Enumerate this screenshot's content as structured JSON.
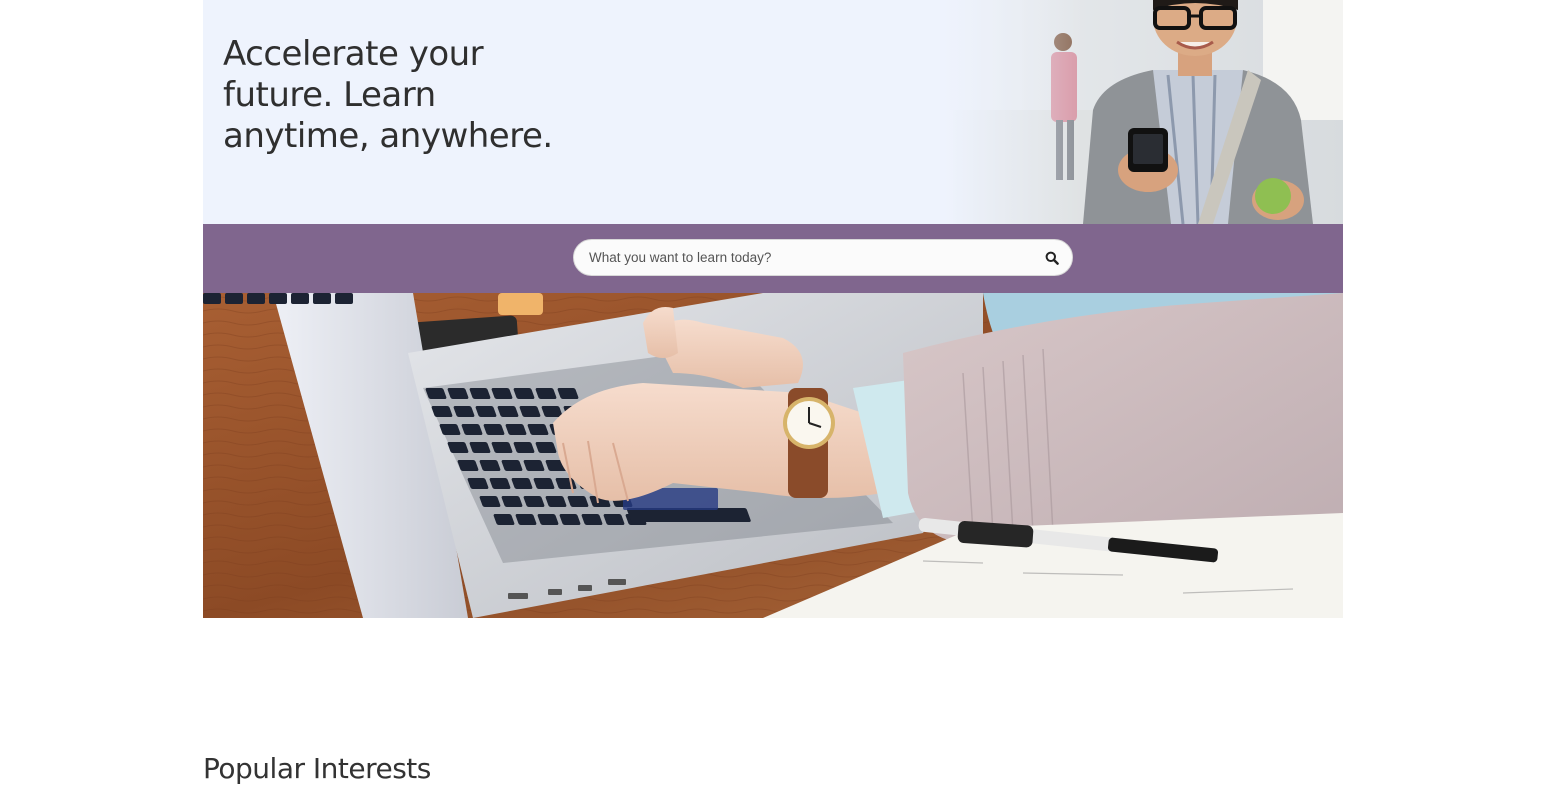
{
  "hero": {
    "headline": "Accelerate your future. Learn anytime, anywhere."
  },
  "search": {
    "placeholder": "What you want to learn today?",
    "icon": "search-icon"
  },
  "colors": {
    "hero_bg": "#eef3fd",
    "search_band": "#80668e",
    "text": "#333333"
  },
  "popular": {
    "heading": "Popular Interests"
  }
}
